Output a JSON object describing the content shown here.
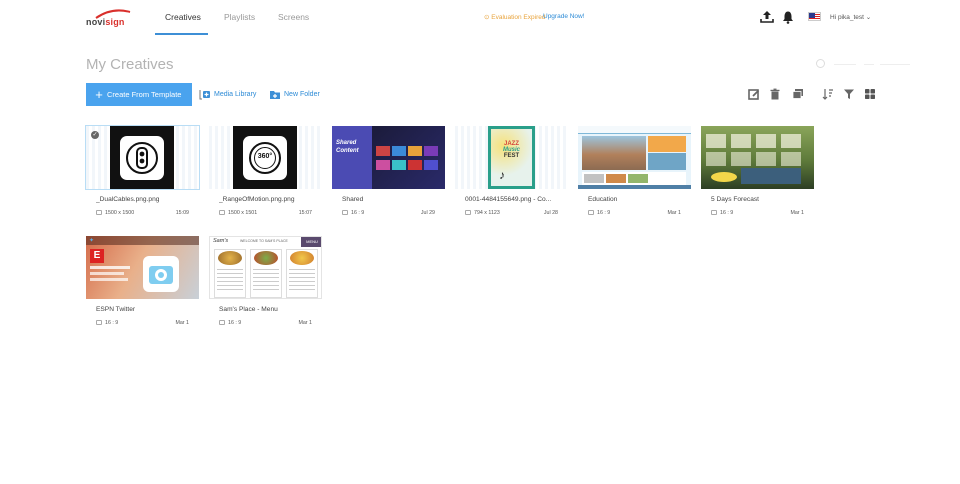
{
  "brand": {
    "logo_text_left": "novi",
    "logo_text_right": "sign"
  },
  "nav": {
    "tabs": [
      {
        "label": "Creatives",
        "active": true
      },
      {
        "label": "Playlists",
        "active": false
      },
      {
        "label": "Screens",
        "active": false
      }
    ]
  },
  "banner": {
    "evaluation_text": "Evaluation Expired",
    "upgrade_text": "Upgrade Now!"
  },
  "user": {
    "greeting": "Hi pika_test"
  },
  "page": {
    "title": "My Creatives"
  },
  "toolbar": {
    "create_label": "Create From Template",
    "media_library_label": "Media Library",
    "new_folder_label": "New Folder"
  },
  "creatives": [
    {
      "name": "_DualCables.png.png",
      "meta": "1500 x 1500",
      "date": "15:09",
      "selected": true
    },
    {
      "name": "_RangeOfMotion.png.png",
      "meta": "1500 x 1501",
      "date": "15:07",
      "selected": false
    },
    {
      "name": "Shared",
      "meta": "16 : 9",
      "date": "Jul 29",
      "selected": false
    },
    {
      "name": "0001-4484155649.png - Co...",
      "meta": "794 x 1123",
      "date": "Jul 28",
      "selected": false
    },
    {
      "name": "Education",
      "meta": "16 : 9",
      "date": "Mar 1",
      "selected": false
    },
    {
      "name": "5 Days Forecast",
      "meta": "16 : 9",
      "date": "Mar 1",
      "selected": false
    },
    {
      "name": "ESPN Twitter",
      "meta": "16 : 9",
      "date": "Mar 1",
      "selected": false
    },
    {
      "name": "Sam's Place - Menu",
      "meta": "16 : 9",
      "date": "Mar 1",
      "selected": false
    }
  ],
  "thumb_text": {
    "range_badge": "360°",
    "shared_line1": "Shared",
    "shared_line2": "Content",
    "jazz_line1": "JAZZ",
    "jazz_line2": "Music",
    "jazz_line3": "FEST",
    "menu_title": "Sam's",
    "menu_banner": "WELCOME TO SAM'S PLACE",
    "menu_tag": "MENU"
  },
  "colors": {
    "accent": "#4aa3ee",
    "link": "#2d8bd6",
    "warning": "#e8a33b",
    "nav_underline": "#3d8fd6"
  }
}
